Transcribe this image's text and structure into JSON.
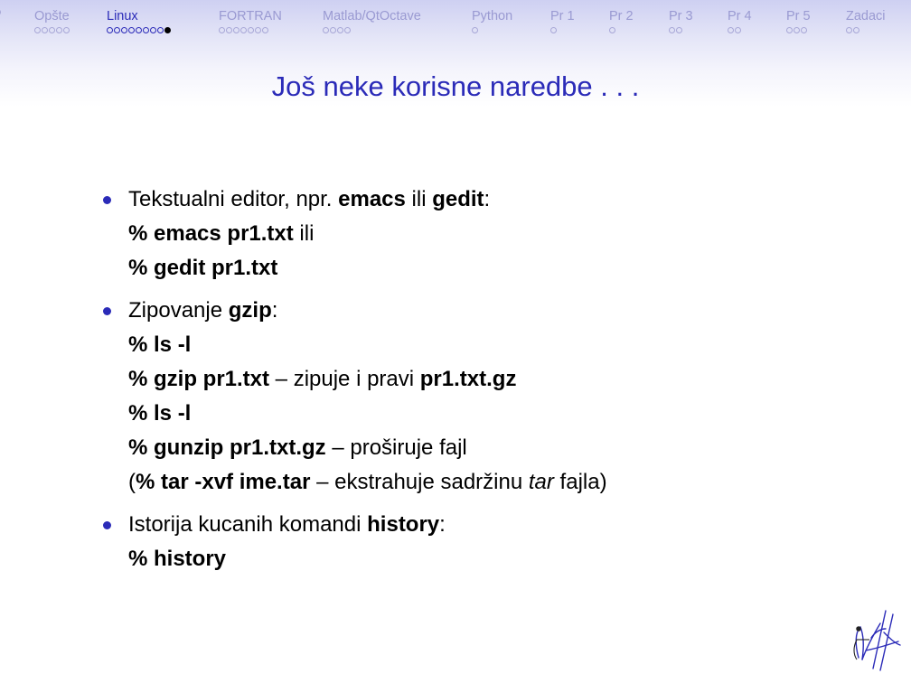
{
  "nav": {
    "sections": [
      {
        "label": "",
        "dots": 1,
        "filled": -1,
        "active": false
      },
      {
        "label": "Opšte",
        "dots": 5,
        "filled": -1,
        "active": false
      },
      {
        "label": "Linux",
        "dots": 9,
        "filled": 8,
        "active": true
      },
      {
        "label": "FORTRAN",
        "dots": 7,
        "filled": -1,
        "active": false
      },
      {
        "label": "Matlab/QtOctave",
        "dots": 4,
        "filled": -1,
        "active": false
      },
      {
        "label": "Python",
        "dots": 1,
        "filled": -1,
        "active": false
      },
      {
        "label": "Pr 1",
        "dots": 1,
        "filled": -1,
        "active": false
      },
      {
        "label": "Pr 2",
        "dots": 1,
        "filled": -1,
        "active": false
      },
      {
        "label": "Pr 3",
        "dots": 2,
        "filled": -1,
        "active": false
      },
      {
        "label": "Pr 4",
        "dots": 2,
        "filled": -1,
        "active": false
      },
      {
        "label": "Pr 5",
        "dots": 3,
        "filled": -1,
        "active": false
      },
      {
        "label": "Zadaci",
        "dots": 2,
        "filled": -1,
        "active": false
      }
    ]
  },
  "slide": {
    "title": "Još neke korisne naredbe . . .",
    "items": [
      {
        "lines": [
          [
            {
              "t": "Tekstualni editor, npr. "
            },
            {
              "t": "emacs",
              "b": true
            },
            {
              "t": " ili "
            },
            {
              "t": "gedit",
              "b": true
            },
            {
              "t": ":"
            }
          ],
          [
            {
              "t": "% emacs pr1.txt",
              "b": true
            },
            {
              "t": " ili"
            }
          ],
          [
            {
              "t": "% gedit pr1.txt",
              "b": true
            }
          ]
        ]
      },
      {
        "lines": [
          [
            {
              "t": "Zipovanje "
            },
            {
              "t": "gzip",
              "b": true
            },
            {
              "t": ":"
            }
          ],
          [
            {
              "t": "% ls -l",
              "b": true
            }
          ],
          [
            {
              "t": "% gzip pr1.txt",
              "b": true
            },
            {
              "t": " – zipuje i pravi "
            },
            {
              "t": "pr1.txt.gz",
              "b": true
            }
          ],
          [
            {
              "t": "% ls -l",
              "b": true
            }
          ],
          [
            {
              "t": "% gunzip pr1.txt.gz",
              "b": true
            },
            {
              "t": " – proširuje fajl"
            }
          ],
          [
            {
              "t": "("
            },
            {
              "t": "% tar -xvf ime.tar",
              "b": true
            },
            {
              "t": " – ekstrahuje sadržinu "
            },
            {
              "t": "tar",
              "i": true
            },
            {
              "t": " fajla)"
            }
          ]
        ]
      },
      {
        "lines": [
          [
            {
              "t": "Istorija kucanih komandi "
            },
            {
              "t": "history",
              "b": true
            },
            {
              "t": ":"
            }
          ],
          [
            {
              "t": "% history",
              "b": true
            }
          ]
        ]
      }
    ]
  },
  "colors": {
    "accent": "#2b2bb8",
    "nav_inactive": "#9a9ad2",
    "header_gradient_top": "#ced0f2"
  },
  "icons": {
    "logo": "university-logo-icon"
  }
}
